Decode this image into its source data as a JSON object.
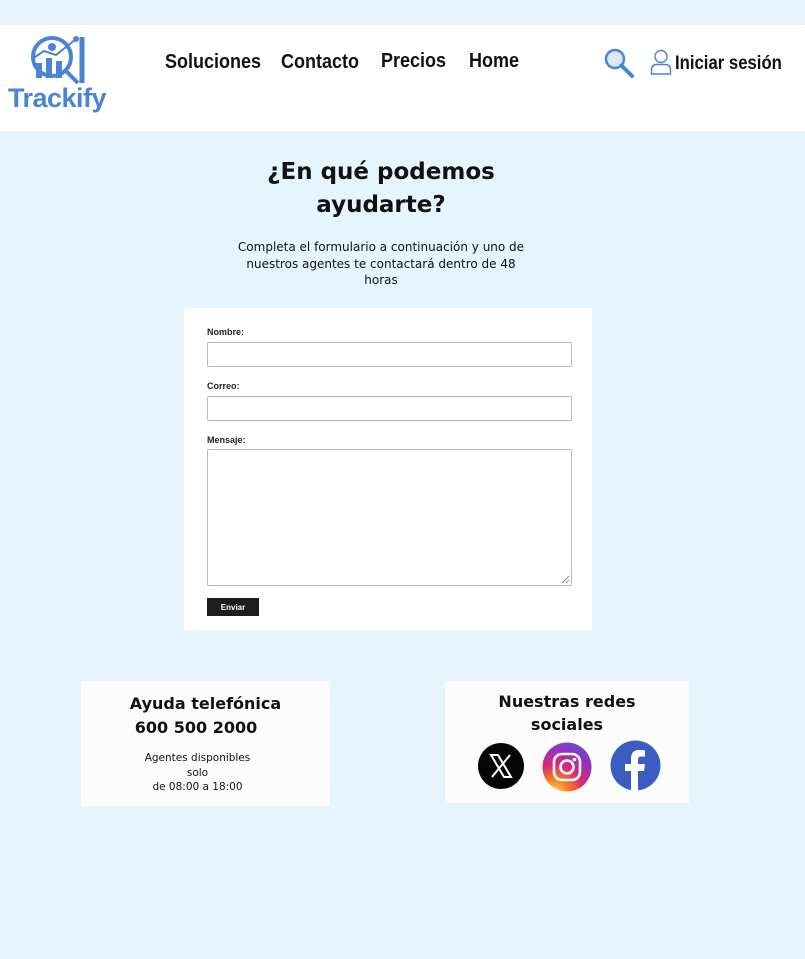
{
  "header": {
    "logo_text": "Trackify",
    "nav": {
      "soluciones": "Soluciones",
      "contacto": "Contacto",
      "precios": "Precios",
      "home": "Home"
    },
    "login_label": "Iniciar sesión"
  },
  "main": {
    "title_line1": "¿En qué podemos",
    "title_line2": "ayudarte?",
    "subtitle_line1": "Completa el formulario a continuación y uno de",
    "subtitle_line2": "nuestros agentes te contactará dentro de 48 horas"
  },
  "form": {
    "name_label": "Nombre:",
    "name_value": "",
    "email_label": "Correo:",
    "email_value": "",
    "message_label": "Mensaje:",
    "message_value": "",
    "submit_label": "Enviar"
  },
  "phone_help": {
    "title": "Ayuda telefónica",
    "number": "600 500 2000",
    "line1": "Agentes disponibles",
    "line2": "solo",
    "line3": "de 08:00 a 18:00"
  },
  "social": {
    "title_line1": "Nuestras redes",
    "title_line2": "sociales",
    "icons": [
      "x-icon",
      "instagram-icon",
      "facebook-icon"
    ]
  },
  "colors": {
    "page_background": "#e6f4fe",
    "brand_blue": "#4a84d3",
    "facebook_blue": "#3b5dbf"
  }
}
